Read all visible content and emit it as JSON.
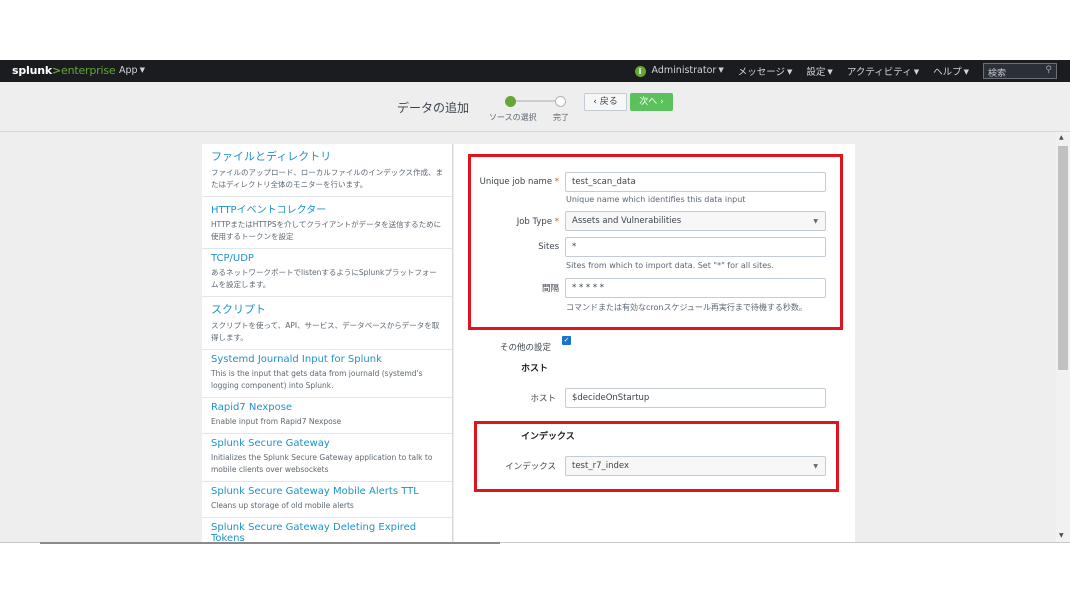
{
  "topnav": {
    "logo_splunk": "splunk",
    "logo_gt": ">",
    "logo_product": "enterprise",
    "app_menu": "App",
    "user": "Administrator",
    "messages": "メッセージ",
    "settings": "設定",
    "activity": "アクティビティ",
    "help": "ヘルプ",
    "search_placeholder": "検索",
    "info_icon": "i"
  },
  "stepbar": {
    "title": "データの追加",
    "step1_label": "ソースの選択",
    "step2_label": "完了",
    "back_label": "‹ 戻る",
    "next_label": "次へ ›"
  },
  "sources": [
    {
      "title": "ファイルとディレクトリ",
      "desc": "ファイルのアップロード、ローカルファイルのインデックス作成、またはディレクトリ全体のモニターを行います。"
    },
    {
      "title": "HTTPイベントコレクター",
      "desc": "HTTPまたはHTTPSを介してクライアントがデータを送信するために使用するトークンを設定"
    },
    {
      "title": "TCP/UDP",
      "desc": "あるネットワークポートでlistenするようにSplunkプラットフォームを設定します。"
    },
    {
      "title": "スクリプト",
      "desc": "スクリプトを使って、API、サービス、データベースからデータを取得します。"
    },
    {
      "title": "Systemd Journald Input for Splunk",
      "desc": "This is the input that gets data from journald (systemd's logging component) into Splunk."
    },
    {
      "title": "Rapid7 Nexpose",
      "desc": "Enable input from Rapid7 Nexpose"
    },
    {
      "title": "Splunk Secure Gateway",
      "desc": "Initializes the Splunk Secure Gateway application to talk to mobile clients over websockets"
    },
    {
      "title": "Splunk Secure Gateway Mobile Alerts TTL",
      "desc": "Cleans up storage of old mobile alerts"
    },
    {
      "title": "Splunk Secure Gateway Deleting Expired Tokens",
      "desc": ""
    }
  ],
  "form": {
    "unique_job_label": "Unique job name",
    "required_mark": "*",
    "unique_job_value": "test_scan_data",
    "unique_job_help": "Unique name which identifies this data input",
    "job_type_label": "Job Type",
    "job_type_value": "Assets and Vulnerabilities",
    "sites_label": "Sites",
    "sites_value": "*",
    "sites_help": "Sites from which to import data. Set \"*\" for all sites.",
    "interval_label": "間隔",
    "interval_value": "* * * * *",
    "interval_help": "コマンドまたは有効なcronスケジュール再実行まで待機する秒数。",
    "other_settings_label": "その他の設定",
    "host_section": "ホスト",
    "host_label": "ホスト",
    "host_value": "$decideOnStartup",
    "index_section": "インデックス",
    "index_label": "インデックス",
    "index_value": "test_r7_index"
  }
}
